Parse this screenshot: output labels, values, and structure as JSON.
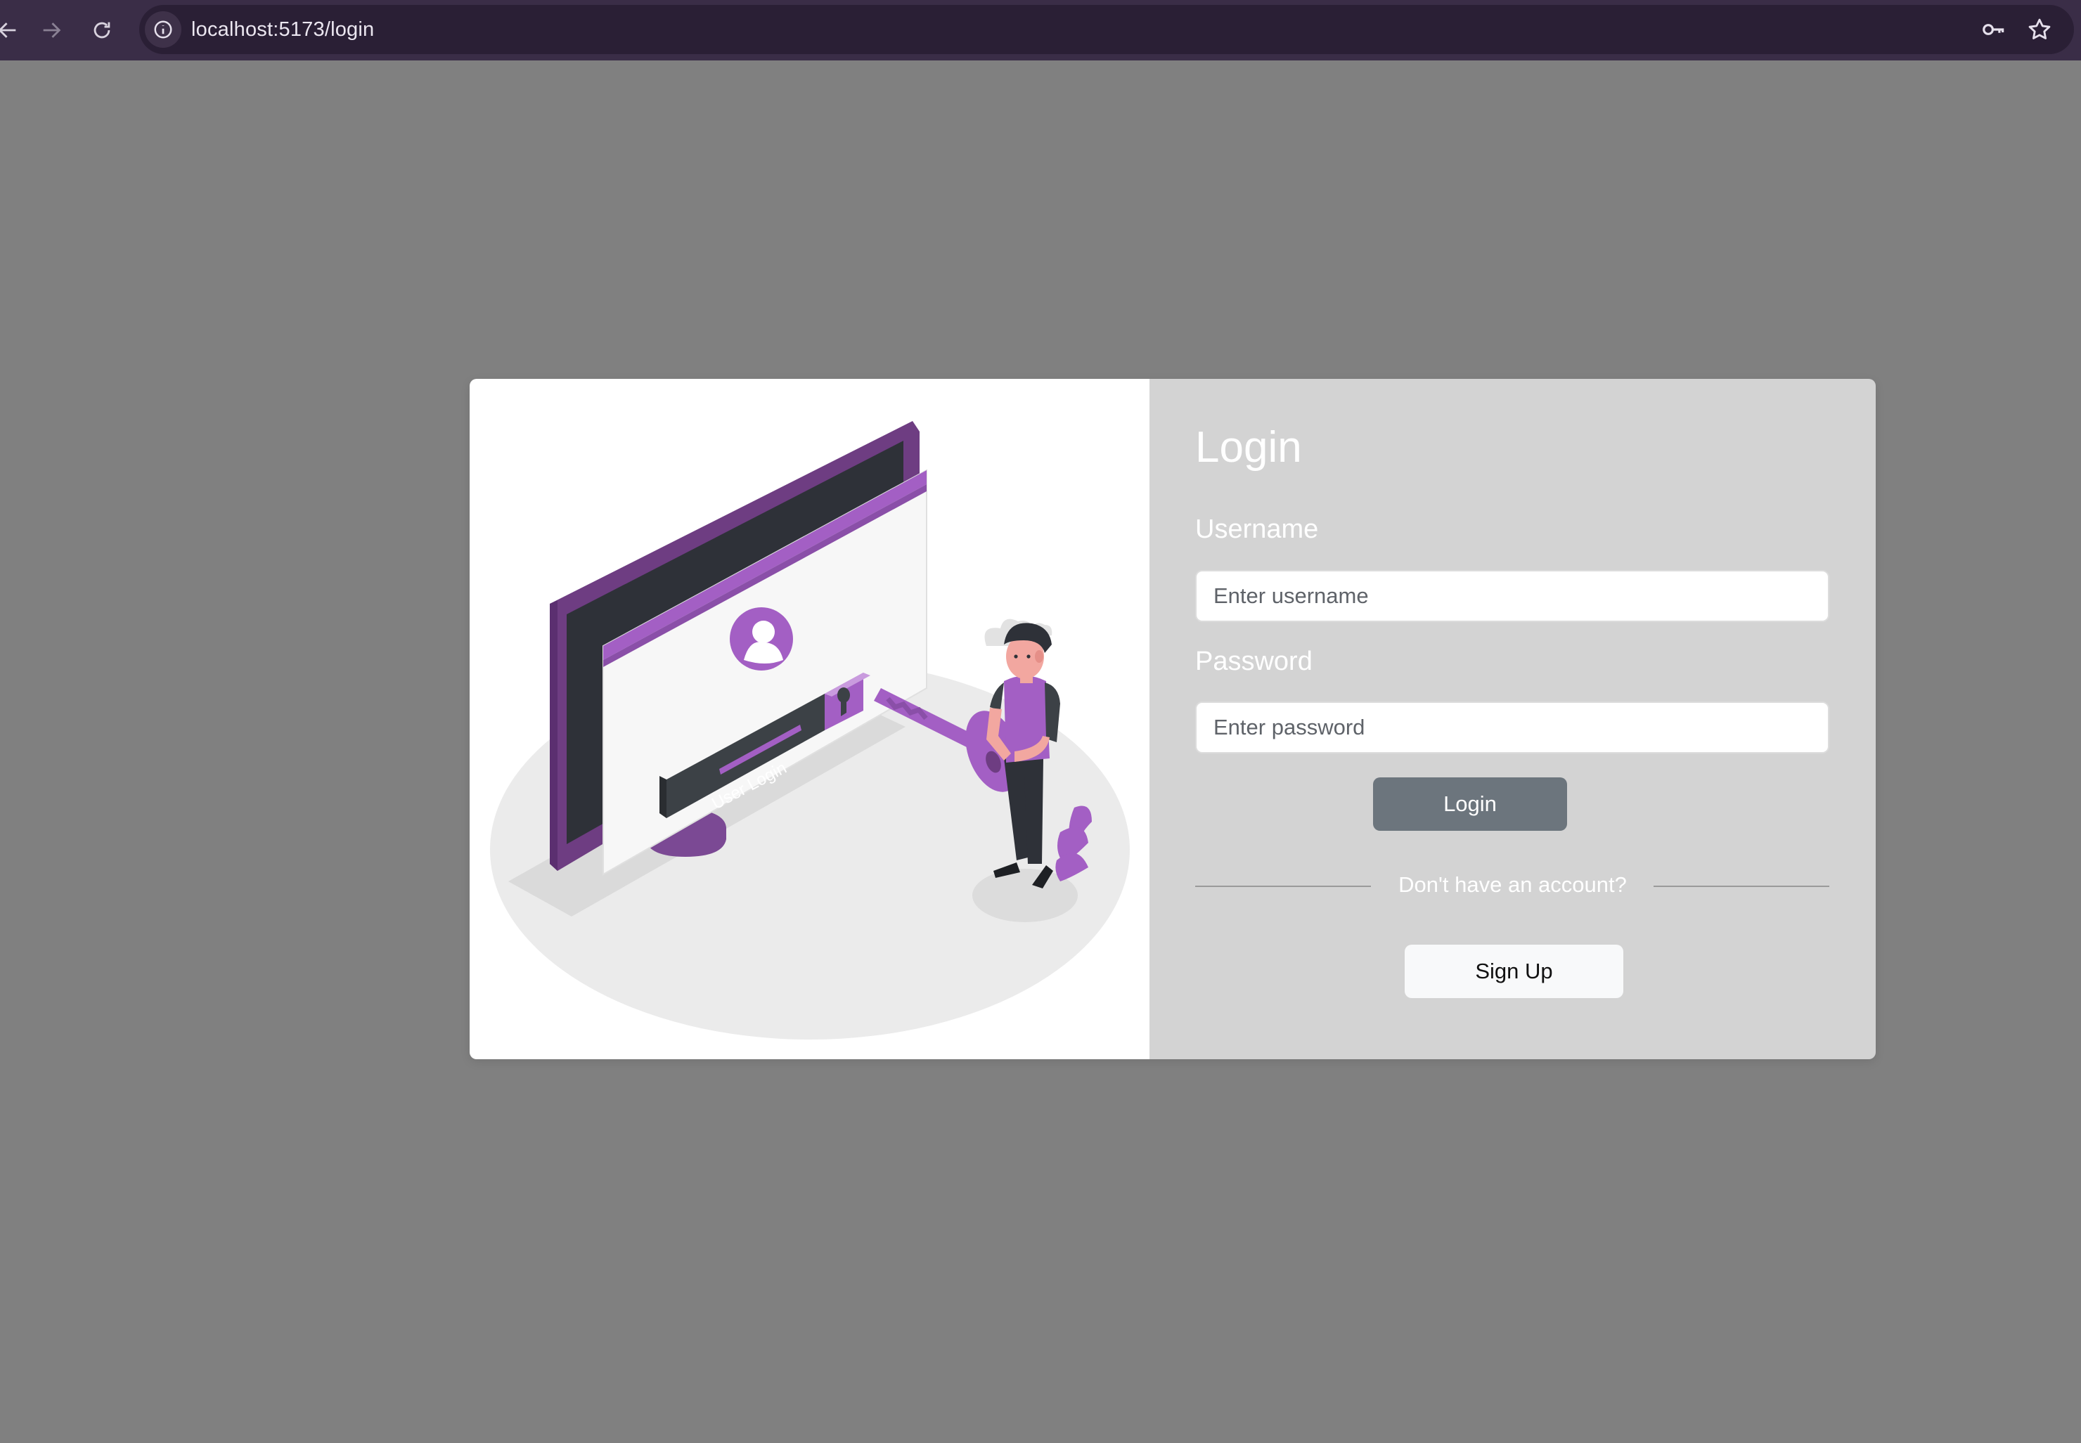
{
  "browser": {
    "url": "localhost:5173/login",
    "back_icon": "arrow-left-icon",
    "forward_icon": "arrow-right-icon",
    "reload_icon": "reload-icon",
    "site_info_icon": "info-icon",
    "password_icon": "key-icon",
    "bookmark_icon": "star-icon"
  },
  "illustration": {
    "screen_text": "User Login"
  },
  "login": {
    "title": "Login",
    "username_label": "Username",
    "username_placeholder": "Enter username",
    "username_value": "",
    "password_label": "Password",
    "password_placeholder": "Enter password",
    "password_value": "",
    "login_button": "Login",
    "divider_text": "Don't have an account?",
    "signup_button": "Sign Up"
  },
  "colors": {
    "page_background": "#808080",
    "form_panel": "#d3d3d3",
    "login_button": "#6c757d",
    "accent_purple": "#a35fc4",
    "dark_purple": "#6e3d82"
  }
}
